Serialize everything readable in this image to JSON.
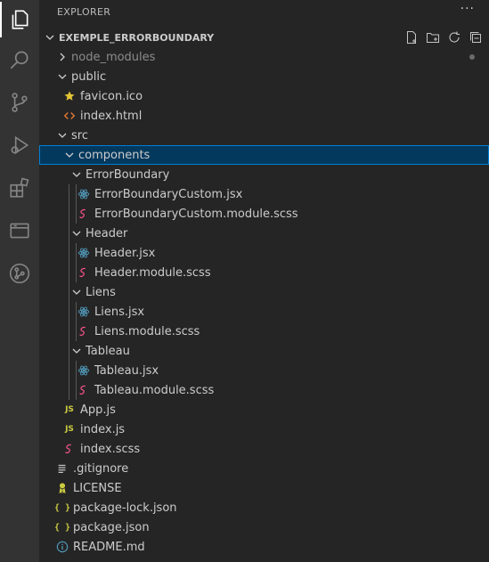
{
  "explorer": {
    "title": "EXPLORER",
    "more": "···",
    "root": "EXEMPLE_ERRORBOUNDARY"
  },
  "tree": [
    {
      "label": "node_modules",
      "depth": 1,
      "kind": "folder-collapsed",
      "icon": "chevron-right-icon",
      "dim": true
    },
    {
      "label": "public",
      "depth": 1,
      "kind": "folder-open",
      "icon": "chevron-down-icon"
    },
    {
      "label": "favicon.ico",
      "depth": 2,
      "kind": "file",
      "icon": "star-icon",
      "color": "#e2c534"
    },
    {
      "label": "index.html",
      "depth": 2,
      "kind": "file",
      "icon": "html-icon",
      "color": "#e37933"
    },
    {
      "label": "src",
      "depth": 1,
      "kind": "folder-open",
      "icon": "chevron-down-icon"
    },
    {
      "label": "components",
      "depth": 2,
      "kind": "folder-open",
      "icon": "chevron-down-icon",
      "selected": true
    },
    {
      "label": "ErrorBoundary",
      "depth": 3,
      "kind": "folder-open",
      "icon": "chevron-down-icon"
    },
    {
      "label": "ErrorBoundaryCustom.jsx",
      "depth": 4,
      "kind": "file",
      "icon": "react-icon",
      "color": "#519aba"
    },
    {
      "label": "ErrorBoundaryCustom.module.scss",
      "depth": 4,
      "kind": "file",
      "icon": "sass-icon",
      "color": "#f55385"
    },
    {
      "label": "Header",
      "depth": 3,
      "kind": "folder-open",
      "icon": "chevron-down-icon"
    },
    {
      "label": "Header.jsx",
      "depth": 4,
      "kind": "file",
      "icon": "react-icon",
      "color": "#519aba"
    },
    {
      "label": "Header.module.scss",
      "depth": 4,
      "kind": "file",
      "icon": "sass-icon",
      "color": "#f55385"
    },
    {
      "label": "Liens",
      "depth": 3,
      "kind": "folder-open",
      "icon": "chevron-down-icon"
    },
    {
      "label": "Liens.jsx",
      "depth": 4,
      "kind": "file",
      "icon": "react-icon",
      "color": "#519aba"
    },
    {
      "label": "Liens.module.scss",
      "depth": 4,
      "kind": "file",
      "icon": "sass-icon",
      "color": "#f55385"
    },
    {
      "label": "Tableau",
      "depth": 3,
      "kind": "folder-open",
      "icon": "chevron-down-icon"
    },
    {
      "label": "Tableau.jsx",
      "depth": 4,
      "kind": "file",
      "icon": "react-icon",
      "color": "#519aba"
    },
    {
      "label": "Tableau.module.scss",
      "depth": 4,
      "kind": "file",
      "icon": "sass-icon",
      "color": "#f55385"
    },
    {
      "label": "App.js",
      "depth": 2,
      "kind": "file",
      "icon": "js-icon",
      "color": "#cbcb41"
    },
    {
      "label": "index.js",
      "depth": 2,
      "kind": "file",
      "icon": "js-icon",
      "color": "#cbcb41"
    },
    {
      "label": "index.scss",
      "depth": 2,
      "kind": "file",
      "icon": "sass-icon",
      "color": "#f55385"
    },
    {
      "label": ".gitignore",
      "depth": 1,
      "kind": "file",
      "icon": "lines-icon",
      "color": "#c5c5c5"
    },
    {
      "label": "LICENSE",
      "depth": 1,
      "kind": "file",
      "icon": "license-icon",
      "color": "#cbcb41"
    },
    {
      "label": "package-lock.json",
      "depth": 1,
      "kind": "file",
      "icon": "json-icon",
      "color": "#cbcb41"
    },
    {
      "label": "package.json",
      "depth": 1,
      "kind": "file",
      "icon": "json-icon",
      "color": "#cbcb41"
    },
    {
      "label": "README.md",
      "depth": 1,
      "kind": "file",
      "icon": "info-icon",
      "color": "#519aba"
    }
  ],
  "colors": {
    "selection_bg": "#04395e",
    "selection_border": "#007fd4",
    "activity_bar": "#333333",
    "sidebar": "#252526"
  }
}
